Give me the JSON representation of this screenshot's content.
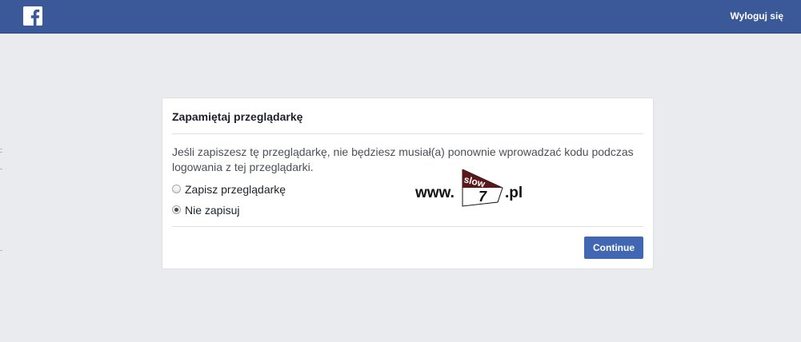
{
  "header": {
    "logo_icon": "facebook-f-icon",
    "logout_label": "Wyloguj się"
  },
  "dialog": {
    "title": "Zapamiętaj przeglądarkę",
    "description": "Jeśli zapiszesz tę przeglądarkę, nie będziesz musiał(a) ponownie wprowadzać kodu podczas logowania z tej przeglądarki.",
    "options": [
      {
        "label": "Zapisz przeglądarkę",
        "selected": false
      },
      {
        "label": "Nie zapisuj",
        "selected": true
      }
    ],
    "continue_label": "Continue"
  },
  "watermark": {
    "prefix": "www.",
    "flag_text": "slow",
    "number": "7",
    "suffix": ".pl"
  },
  "colors": {
    "topbar": "#3b5998",
    "background": "#e9ebee",
    "button": "#4267b2"
  }
}
